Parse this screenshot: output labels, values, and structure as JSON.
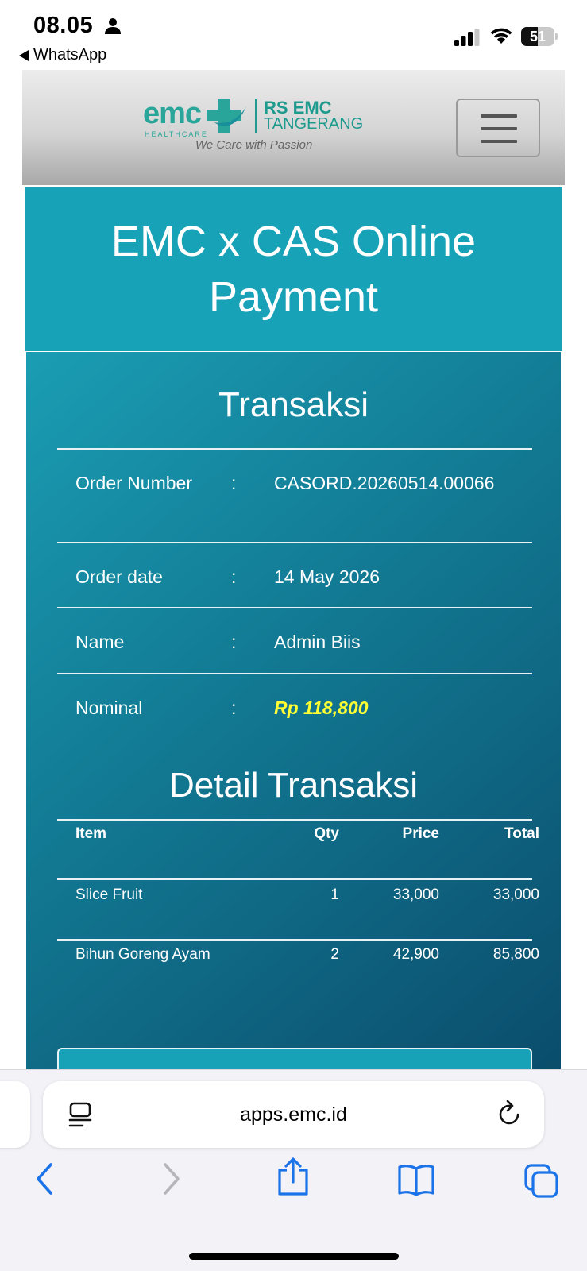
{
  "status_bar": {
    "time": "08.05",
    "back_app": "WhatsApp",
    "battery": "51",
    "battery_level": 0.51,
    "icons": [
      "person-icon",
      "signal-icon",
      "wifi-icon",
      "battery-icon"
    ]
  },
  "header": {
    "logo": {
      "brand": "emc",
      "healthcare": "HEALTHCARE",
      "rs": "RS EMC",
      "city": "TANGERANG",
      "tagline": "We Care with Passion"
    },
    "menu_icon": "hamburger-icon"
  },
  "banner": {
    "title": "EMC x CAS Online Payment"
  },
  "transaction": {
    "heading": "Transaksi",
    "rows": [
      {
        "label": "Order Number",
        "colon": ":",
        "value": "CASORD.20260514.00066"
      },
      {
        "label": "Order date",
        "colon": ":",
        "value": "14 May 2026"
      },
      {
        "label": "Name",
        "colon": ":",
        "value": "Admin Biis"
      },
      {
        "label": "Nominal",
        "colon": ":",
        "value": "Rp 118,800"
      }
    ]
  },
  "detail": {
    "heading": "Detail Transaksi",
    "columns": [
      "Item",
      "Qty",
      "Price",
      "Total"
    ],
    "rows": [
      {
        "item": "Slice Fruit",
        "qty": "1",
        "price": "33,000",
        "total": "33,000"
      },
      {
        "item": "Bihun Goreng Ayam",
        "qty": "2",
        "price": "42,900",
        "total": "85,800"
      }
    ]
  },
  "browser": {
    "url": "apps.emc.id",
    "icons": [
      "reader-icon",
      "reload-icon",
      "back-icon",
      "forward-icon",
      "share-icon",
      "bookmarks-icon",
      "tabs-icon"
    ],
    "accent": "#1a73e8"
  },
  "colors": {
    "brand_teal": "#17a2b8",
    "nominal_yellow": "#ffff33",
    "logo_green": "#2aa59a"
  }
}
